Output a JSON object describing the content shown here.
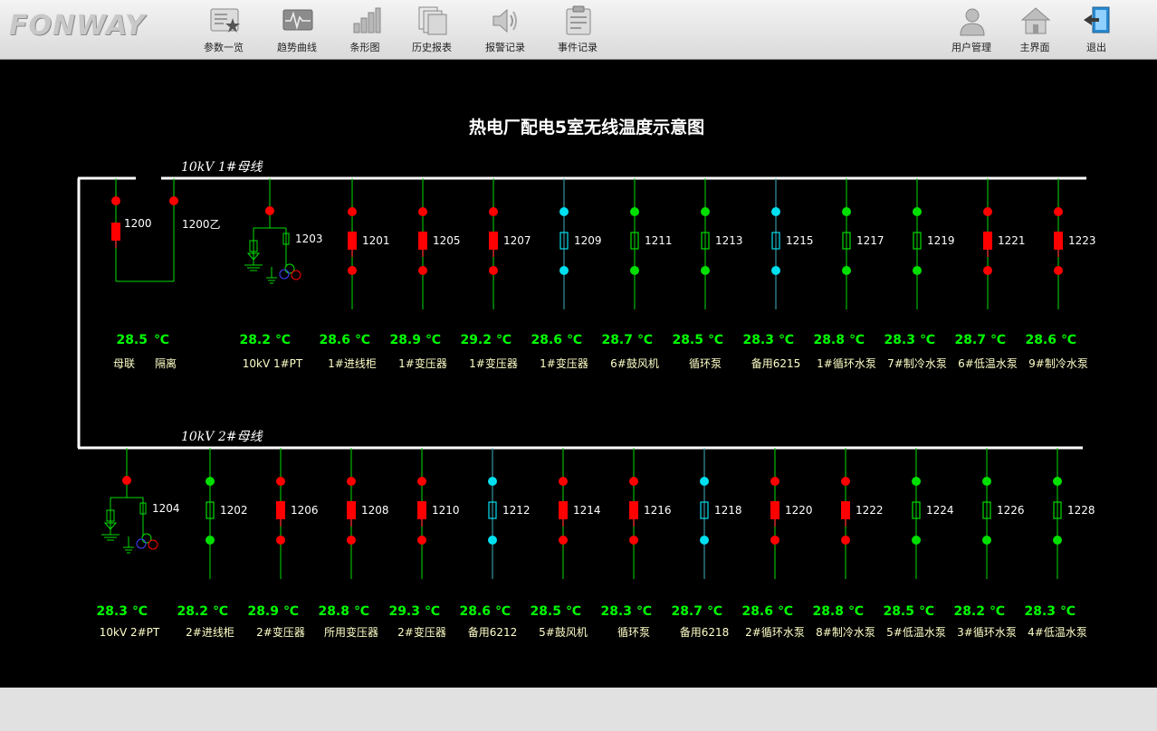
{
  "app": {
    "logo_text": "FONWAY"
  },
  "toolbar": {
    "left_buttons": [
      {
        "label": "参数一览",
        "icon": "parameter-list-icon"
      },
      {
        "label": "趋势曲线",
        "icon": "trend-curve-icon"
      },
      {
        "label": "条形图",
        "icon": "bar-chart-icon"
      },
      {
        "label": "历史报表",
        "icon": "history-report-icon"
      },
      {
        "label": "报警记录",
        "icon": "alarm-record-icon"
      },
      {
        "label": "事件记录",
        "icon": "event-record-icon"
      }
    ],
    "right_buttons": [
      {
        "label": "用户管理",
        "icon": "user-management-icon"
      },
      {
        "label": "主界面",
        "icon": "home-icon"
      },
      {
        "label": "退出",
        "icon": "exit-icon"
      }
    ]
  },
  "diagram": {
    "title": "热电厂配电5室无线温度示意图",
    "bus1_label": "10kV 1#母线",
    "bus2_label": "10kV 2#母线",
    "temp_unit": "℃",
    "colors": {
      "red": "#ff0000",
      "green": "#00e000",
      "cyan": "#00e0f0",
      "temp_text": "#00ff00",
      "name_text": "#ffffc8",
      "line": "#00dd00"
    },
    "bus_tie": {
      "labels": [
        "1200",
        "1200乙"
      ],
      "temp": "28.5",
      "names": [
        "母联",
        "隔离"
      ],
      "color": "red"
    },
    "row1": [
      {
        "id": "1203",
        "temp": "28.2",
        "name": "10kV 1#PT",
        "type": "pt",
        "color": "red"
      },
      {
        "id": "1201",
        "temp": "28.6",
        "name": "1#进线柜",
        "color": "red"
      },
      {
        "id": "1205",
        "temp": "28.9",
        "name": "1#变压器",
        "color": "red"
      },
      {
        "id": "1207",
        "temp": "29.2",
        "name": "1#变压器",
        "color": "red"
      },
      {
        "id": "1209",
        "temp": "28.6",
        "name": "1#变压器",
        "color": "cyan"
      },
      {
        "id": "1211",
        "temp": "28.7",
        "name": "6#鼓风机",
        "color": "green"
      },
      {
        "id": "1213",
        "temp": "28.5",
        "name": "循环泵",
        "color": "green"
      },
      {
        "id": "1215",
        "temp": "28.3",
        "name": "备用6215",
        "color": "cyan"
      },
      {
        "id": "1217",
        "temp": "28.8",
        "name": "1#循环水泵",
        "color": "green"
      },
      {
        "id": "1219",
        "temp": "28.3",
        "name": "7#制冷水泵",
        "color": "green"
      },
      {
        "id": "1221",
        "temp": "28.7",
        "name": "6#低温水泵",
        "color": "red"
      },
      {
        "id": "1223",
        "temp": "28.6",
        "name": "9#制冷水泵",
        "color": "red"
      }
    ],
    "row2": [
      {
        "id": "1204",
        "temp": "28.3",
        "name": "10kV 2#PT",
        "type": "pt",
        "color": "red"
      },
      {
        "id": "1202",
        "temp": "28.2",
        "name": "2#进线柜",
        "color": "green"
      },
      {
        "id": "1206",
        "temp": "28.9",
        "name": "2#变压器",
        "color": "red"
      },
      {
        "id": "1208",
        "temp": "28.8",
        "name": "所用变压器",
        "color": "red"
      },
      {
        "id": "1210",
        "temp": "29.3",
        "name": "2#变压器",
        "color": "red"
      },
      {
        "id": "1212",
        "temp": "28.6",
        "name": "备用6212",
        "color": "cyan"
      },
      {
        "id": "1214",
        "temp": "28.5",
        "name": "5#鼓风机",
        "color": "red"
      },
      {
        "id": "1216",
        "temp": "28.3",
        "name": "循环泵",
        "color": "red"
      },
      {
        "id": "1218",
        "temp": "28.7",
        "name": "备用6218",
        "color": "cyan"
      },
      {
        "id": "1220",
        "temp": "28.6",
        "name": "2#循环水泵",
        "color": "red"
      },
      {
        "id": "1222",
        "temp": "28.8",
        "name": "8#制冷水泵",
        "color": "red"
      },
      {
        "id": "1224",
        "temp": "28.5",
        "name": "5#低温水泵",
        "color": "green"
      },
      {
        "id": "1226",
        "temp": "28.2",
        "name": "3#循环水泵",
        "color": "green"
      },
      {
        "id": "1228",
        "temp": "28.3",
        "name": "4#低温水泵",
        "color": "green"
      }
    ]
  }
}
